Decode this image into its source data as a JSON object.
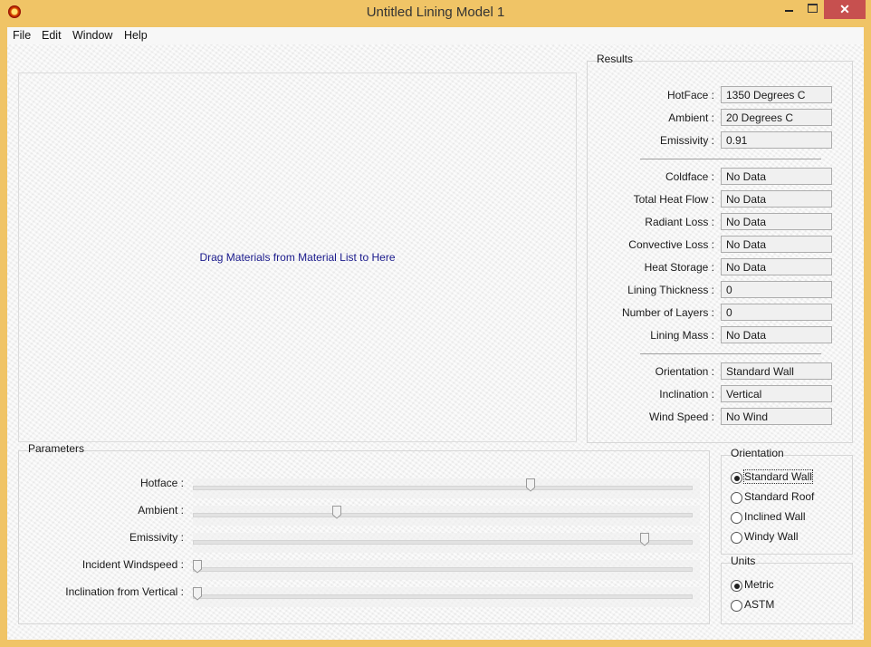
{
  "window": {
    "title": "Untitled Lining Model 1",
    "minimize_icon": "minimize-icon",
    "maximize_icon": "maximize-icon",
    "close_icon": "close-icon",
    "close_glyph": "✕"
  },
  "menu": {
    "items": [
      "File",
      "Edit",
      "Window",
      "Help"
    ]
  },
  "canvas": {
    "hint": "Drag Materials from Material List to Here"
  },
  "results": {
    "title": "Results",
    "inputs": [
      {
        "label": "HotFace :",
        "value": "1350 Degrees C"
      },
      {
        "label": "Ambient :",
        "value": "20 Degrees C"
      },
      {
        "label": "Emissivity :",
        "value": "0.91"
      }
    ],
    "outputs": [
      {
        "label": "Coldface :",
        "value": "No Data"
      },
      {
        "label": "Total Heat Flow :",
        "value": "No Data"
      },
      {
        "label": "Radiant Loss :",
        "value": "No Data"
      },
      {
        "label": "Convective Loss :",
        "value": "No Data"
      },
      {
        "label": "Heat Storage :",
        "value": "No Data"
      },
      {
        "label": "Lining Thickness :",
        "value": "0"
      },
      {
        "label": "Number of Layers :",
        "value": "0"
      },
      {
        "label": "Lining Mass :",
        "value": "No Data"
      }
    ],
    "conditions": [
      {
        "label": "Orientation :",
        "value": "Standard Wall"
      },
      {
        "label": "Inclination :",
        "value": "Vertical"
      },
      {
        "label": "Wind Speed :",
        "value": "No Wind"
      }
    ]
  },
  "parameters": {
    "title": "Parameters",
    "sliders": [
      {
        "label": "Hotface :",
        "fraction": 0.67
      },
      {
        "label": "Ambient :",
        "fraction": 0.28
      },
      {
        "label": "Emissivity :",
        "fraction": 0.9
      },
      {
        "label": "Incident Windspeed :",
        "fraction": 0.0
      },
      {
        "label": "Inclination from Vertical :",
        "fraction": 0.0
      }
    ]
  },
  "orientation": {
    "title": "Orientation",
    "options": [
      {
        "label": "Standard Wall",
        "selected": true
      },
      {
        "label": "Standard Roof",
        "selected": false
      },
      {
        "label": "Inclined Wall",
        "selected": false
      },
      {
        "label": "Windy Wall",
        "selected": false
      }
    ]
  },
  "units": {
    "title": "Units",
    "options": [
      {
        "label": "Metric",
        "selected": true
      },
      {
        "label": "ASTM",
        "selected": false
      }
    ]
  }
}
